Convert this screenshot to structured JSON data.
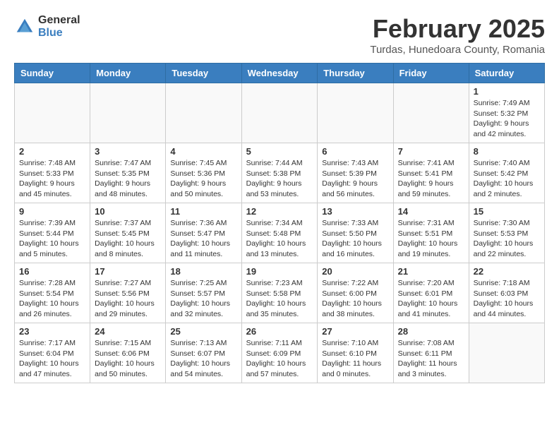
{
  "logo": {
    "general": "General",
    "blue": "Blue"
  },
  "header": {
    "month": "February 2025",
    "location": "Turdas, Hunedoara County, Romania"
  },
  "days_of_week": [
    "Sunday",
    "Monday",
    "Tuesday",
    "Wednesday",
    "Thursday",
    "Friday",
    "Saturday"
  ],
  "weeks": [
    [
      {
        "day": "",
        "info": ""
      },
      {
        "day": "",
        "info": ""
      },
      {
        "day": "",
        "info": ""
      },
      {
        "day": "",
        "info": ""
      },
      {
        "day": "",
        "info": ""
      },
      {
        "day": "",
        "info": ""
      },
      {
        "day": "1",
        "info": "Sunrise: 7:49 AM\nSunset: 5:32 PM\nDaylight: 9 hours and 42 minutes."
      }
    ],
    [
      {
        "day": "2",
        "info": "Sunrise: 7:48 AM\nSunset: 5:33 PM\nDaylight: 9 hours and 45 minutes."
      },
      {
        "day": "3",
        "info": "Sunrise: 7:47 AM\nSunset: 5:35 PM\nDaylight: 9 hours and 48 minutes."
      },
      {
        "day": "4",
        "info": "Sunrise: 7:45 AM\nSunset: 5:36 PM\nDaylight: 9 hours and 50 minutes."
      },
      {
        "day": "5",
        "info": "Sunrise: 7:44 AM\nSunset: 5:38 PM\nDaylight: 9 hours and 53 minutes."
      },
      {
        "day": "6",
        "info": "Sunrise: 7:43 AM\nSunset: 5:39 PM\nDaylight: 9 hours and 56 minutes."
      },
      {
        "day": "7",
        "info": "Sunrise: 7:41 AM\nSunset: 5:41 PM\nDaylight: 9 hours and 59 minutes."
      },
      {
        "day": "8",
        "info": "Sunrise: 7:40 AM\nSunset: 5:42 PM\nDaylight: 10 hours and 2 minutes."
      }
    ],
    [
      {
        "day": "9",
        "info": "Sunrise: 7:39 AM\nSunset: 5:44 PM\nDaylight: 10 hours and 5 minutes."
      },
      {
        "day": "10",
        "info": "Sunrise: 7:37 AM\nSunset: 5:45 PM\nDaylight: 10 hours and 8 minutes."
      },
      {
        "day": "11",
        "info": "Sunrise: 7:36 AM\nSunset: 5:47 PM\nDaylight: 10 hours and 11 minutes."
      },
      {
        "day": "12",
        "info": "Sunrise: 7:34 AM\nSunset: 5:48 PM\nDaylight: 10 hours and 13 minutes."
      },
      {
        "day": "13",
        "info": "Sunrise: 7:33 AM\nSunset: 5:50 PM\nDaylight: 10 hours and 16 minutes."
      },
      {
        "day": "14",
        "info": "Sunrise: 7:31 AM\nSunset: 5:51 PM\nDaylight: 10 hours and 19 minutes."
      },
      {
        "day": "15",
        "info": "Sunrise: 7:30 AM\nSunset: 5:53 PM\nDaylight: 10 hours and 22 minutes."
      }
    ],
    [
      {
        "day": "16",
        "info": "Sunrise: 7:28 AM\nSunset: 5:54 PM\nDaylight: 10 hours and 26 minutes."
      },
      {
        "day": "17",
        "info": "Sunrise: 7:27 AM\nSunset: 5:56 PM\nDaylight: 10 hours and 29 minutes."
      },
      {
        "day": "18",
        "info": "Sunrise: 7:25 AM\nSunset: 5:57 PM\nDaylight: 10 hours and 32 minutes."
      },
      {
        "day": "19",
        "info": "Sunrise: 7:23 AM\nSunset: 5:58 PM\nDaylight: 10 hours and 35 minutes."
      },
      {
        "day": "20",
        "info": "Sunrise: 7:22 AM\nSunset: 6:00 PM\nDaylight: 10 hours and 38 minutes."
      },
      {
        "day": "21",
        "info": "Sunrise: 7:20 AM\nSunset: 6:01 PM\nDaylight: 10 hours and 41 minutes."
      },
      {
        "day": "22",
        "info": "Sunrise: 7:18 AM\nSunset: 6:03 PM\nDaylight: 10 hours and 44 minutes."
      }
    ],
    [
      {
        "day": "23",
        "info": "Sunrise: 7:17 AM\nSunset: 6:04 PM\nDaylight: 10 hours and 47 minutes."
      },
      {
        "day": "24",
        "info": "Sunrise: 7:15 AM\nSunset: 6:06 PM\nDaylight: 10 hours and 50 minutes."
      },
      {
        "day": "25",
        "info": "Sunrise: 7:13 AM\nSunset: 6:07 PM\nDaylight: 10 hours and 54 minutes."
      },
      {
        "day": "26",
        "info": "Sunrise: 7:11 AM\nSunset: 6:09 PM\nDaylight: 10 hours and 57 minutes."
      },
      {
        "day": "27",
        "info": "Sunrise: 7:10 AM\nSunset: 6:10 PM\nDaylight: 11 hours and 0 minutes."
      },
      {
        "day": "28",
        "info": "Sunrise: 7:08 AM\nSunset: 6:11 PM\nDaylight: 11 hours and 3 minutes."
      },
      {
        "day": "",
        "info": ""
      }
    ]
  ]
}
